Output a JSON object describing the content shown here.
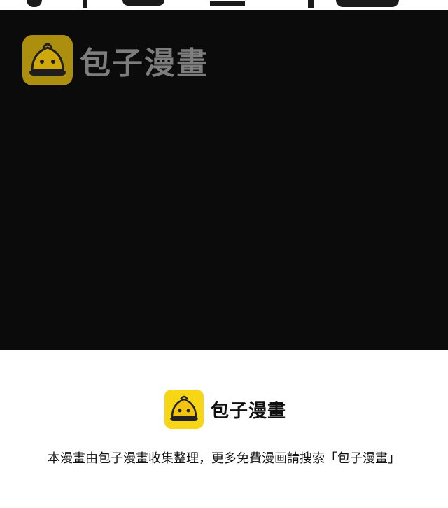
{
  "watermark": {
    "brand": "包子漫畫"
  },
  "footer": {
    "brand": "包子漫畫",
    "notice": "本漫畫由包子漫畫收集整理，更多免費漫画請搜索「包子漫畫」"
  },
  "colors": {
    "panel": "#0b0b0b",
    "logo_yellow": "#f7d616",
    "watermark_gray": "#8a8a8a"
  },
  "icons": {
    "logo": "steamed-bun-icon"
  }
}
